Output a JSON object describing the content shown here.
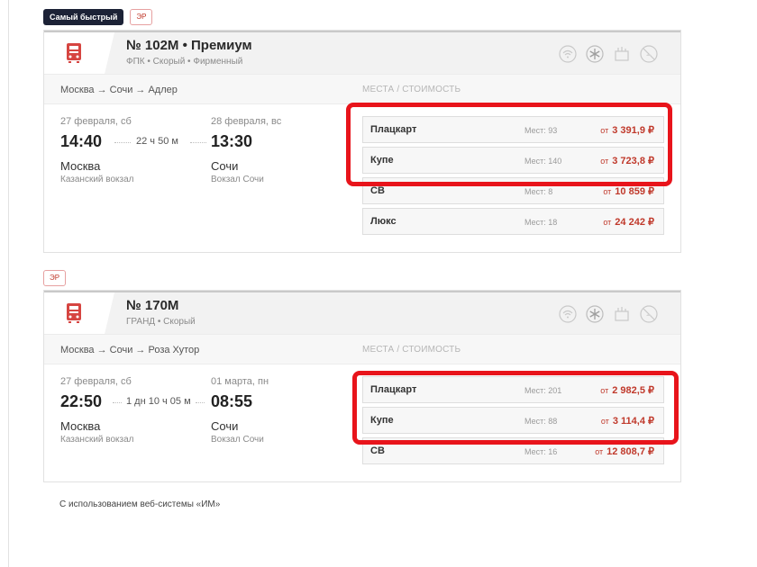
{
  "train1": {
    "badges": [
      "Самый быстрый",
      "ЭР"
    ],
    "number": "№ 102М • Премиум",
    "subtitle": "ФПК • Скорый • Фирменный",
    "route": "Москва → Сочи → Адлер",
    "places_header": "МЕСТА / СТОИМОСТЬ",
    "depart_date": "27 февраля, сб",
    "depart_time": "14:40",
    "duration": "22 ч 50 м",
    "arrive_date": "28 февраля, вс",
    "arrive_time": "13:30",
    "depart_city": "Москва",
    "depart_station": "Казанский вокзал",
    "arrive_city": "Сочи",
    "arrive_station": "Вокзал Сочи",
    "fares": [
      {
        "class": "Плацкарт",
        "seats": "Мест: 93",
        "from": "от",
        "price": "3 391,9 ₽"
      },
      {
        "class": "Купе",
        "seats": "Мест: 140",
        "from": "от",
        "price": "3 723,8 ₽"
      },
      {
        "class": "СВ",
        "seats": "Мест: 8",
        "from": "от",
        "price": "10 859 ₽"
      },
      {
        "class": "Люкс",
        "seats": "Мест: 18",
        "from": "от",
        "price": "24 242 ₽"
      }
    ]
  },
  "train2": {
    "badges": [
      "ЭР"
    ],
    "number": "№ 170М",
    "subtitle": "ГРАНД • Скорый",
    "route": "Москва → Сочи → Роза Хутор",
    "places_header": "МЕСТА / СТОИМОСТЬ",
    "depart_date": "27 февраля, сб",
    "depart_time": "22:50",
    "duration": "1 дн 10 ч 05 м",
    "arrive_date": "01 марта, пн",
    "arrive_time": "08:55",
    "depart_city": "Москва",
    "depart_station": "Казанский вокзал",
    "arrive_city": "Сочи",
    "arrive_station": "Вокзал Сочи",
    "fares": [
      {
        "class": "Плацкарт",
        "seats": "Мест: 201",
        "from": "от",
        "price": "2 982,5 ₽"
      },
      {
        "class": "Купе",
        "seats": "Мест: 88",
        "from": "от",
        "price": "3 114,4 ₽"
      },
      {
        "class": "СВ",
        "seats": "Мест: 16",
        "from": "от",
        "price": "12 808,7 ₽"
      }
    ]
  },
  "amenity_icons": [
    "wifi-icon",
    "snowflake-icon",
    "food-icon",
    "no-pets-icon"
  ],
  "footer": "С использованием веб-системы «ИМ»",
  "colors": {
    "accent_red": "#c0392b",
    "highlight": "#e8141b",
    "badge_dark": "#1c2236"
  }
}
